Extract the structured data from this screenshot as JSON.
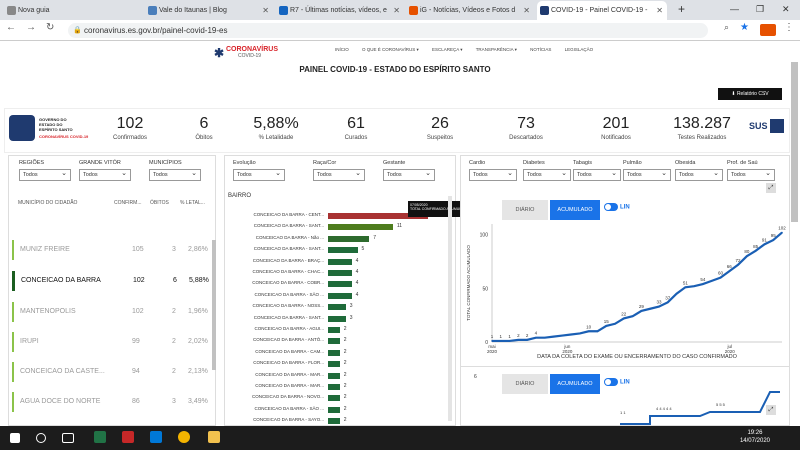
{
  "browser": {
    "tabs": [
      {
        "title": "Nova guia",
        "color": "#888888"
      },
      {
        "title": "Vale do Itaunas | Blog",
        "color": "#4a7ebb"
      },
      {
        "title": "R7 - Últimas notícias, vídeos, e",
        "color": "#1565c0"
      },
      {
        "title": "iG - Notícias, Vídeos e Fotos d",
        "color": "#e65100"
      },
      {
        "title": "COVID-19 - Painel COVID-19 - ",
        "color": "#1f3a6f"
      }
    ],
    "url": "coronavirus.es.gov.br/painel-covid-19-es",
    "new_tab": "+"
  },
  "site": {
    "logo_title": "CORONAVÍRUS",
    "logo_sub": "COVID-19",
    "menu": [
      "INÍCIO",
      "O QUE É CORONAVÍRUS ▾",
      "ESCLAREÇA ▾",
      "TRANSPARÊNCIA ▾",
      "NOTÍCIAS",
      "LEGISLAÇÃO"
    ],
    "page_title": "PAINEL COVID-19 - ESTADO DO ESPÍRITO SANTO",
    "csv_button": "⬇ Relatório CSV"
  },
  "gov": {
    "line1": "GOVERNO DO ESTADO DO ESPÍRITO SANTO",
    "line2": "CORONAVÍRUS COVID-19",
    "sus": "SUS"
  },
  "kpis": [
    {
      "value": "102",
      "label": "Confirmados"
    },
    {
      "value": "6",
      "label": "Óbitos"
    },
    {
      "value": "5,88%",
      "label": "% Letalidade"
    },
    {
      "value": "61",
      "label": "Curados"
    },
    {
      "value": "26",
      "label": "Suspeitos"
    },
    {
      "value": "73",
      "label": "Descartados"
    },
    {
      "value": "201",
      "label": "Notificados"
    },
    {
      "value": "138.287",
      "label": "Testes Realizados"
    }
  ],
  "filters_left": [
    {
      "label": "REGIÕES",
      "value": "Todos"
    },
    {
      "label": "GRANDE VITÓR",
      "value": "Todos"
    },
    {
      "label": "MUNICÍPIOS",
      "value": "Todos"
    }
  ],
  "filters_mid": [
    {
      "label": "Evolução",
      "value": "Todos"
    },
    {
      "label": "Raça/Cor",
      "value": "Todos"
    },
    {
      "label": "Gestante",
      "value": "Todos"
    }
  ],
  "filters_right": [
    {
      "label": "Cardio",
      "value": "Todos"
    },
    {
      "label": "Diabetes",
      "value": "Todos"
    },
    {
      "label": "Tabagis",
      "value": "Todos"
    },
    {
      "label": "Pulmão",
      "value": "Todos"
    },
    {
      "label": "Obesida",
      "value": "Todos"
    },
    {
      "label": "Prof. de Saú",
      "value": "Todos"
    }
  ],
  "mun_table": {
    "headers": [
      "MUNICÍPIO DO CIDADÃO",
      "CONFIRM...",
      "ÓBITOS",
      "% LETAL..."
    ],
    "rows": [
      {
        "name": "MUNIZ FREIRE",
        "conf": "105",
        "ob": "3",
        "let": "2,86%"
      },
      {
        "name": "CONCEICAO DA BARRA",
        "conf": "102",
        "ob": "6",
        "let": "5,88%"
      },
      {
        "name": "MANTENOPOLIS",
        "conf": "102",
        "ob": "2",
        "let": "1,96%"
      },
      {
        "name": "IRUPI",
        "conf": "99",
        "ob": "2",
        "let": "2,02%"
      },
      {
        "name": "CONCEICAO DA CASTE...",
        "conf": "94",
        "ob": "2",
        "let": "2,13%"
      },
      {
        "name": "AGUA DOCE DO NORTE",
        "conf": "86",
        "ob": "3",
        "let": "3,49%"
      }
    ]
  },
  "bairro": {
    "title": "BAIRRO",
    "tooltip_date": "07/05/2020",
    "tooltip_text": "TOTAL CONFIRMADO ACUMULADO",
    "rows": [
      {
        "label": "CONCEICAO DA BARRA - CENT...",
        "value": 17,
        "color": "#a83232"
      },
      {
        "label": "CONCEICAO DA BARRA - SANT...",
        "value": 11,
        "color": "#4e7d1e"
      },
      {
        "label": "CONCEICAO DA BARRA - Não ...",
        "value": 7,
        "color": "#2e6b2e"
      },
      {
        "label": "CONCEICAO DA BARRA - SANT...",
        "value": 5,
        "color": "#1f6b3a"
      },
      {
        "label": "CONCEICAO DA BARRA - BRAÇ...",
        "value": 4,
        "color": "#1f6b3a"
      },
      {
        "label": "CONCEICAO DA BARRA - CHAC...",
        "value": 4,
        "color": "#1f6b3a"
      },
      {
        "label": "CONCEICAO DA BARRA - COBR...",
        "value": 4,
        "color": "#1f6b3a"
      },
      {
        "label": "CONCEICAO DA BARRA - SÃO ...",
        "value": 4,
        "color": "#1f6b3a"
      },
      {
        "label": "CONCEICAO DA BARRA - NOSS...",
        "value": 3,
        "color": "#1f6b3a"
      },
      {
        "label": "CONCEICAO DA BARRA - SANT...",
        "value": 3,
        "color": "#1f6b3a"
      },
      {
        "label": "CONCEICAO DA BARRA - AGUI...",
        "value": 2,
        "color": "#1f6b3a"
      },
      {
        "label": "CONCEICAO DA BARRA - ANTÔ...",
        "value": 2,
        "color": "#1f6b3a"
      },
      {
        "label": "CONCEICAO DA BARRA - CAM...",
        "value": 2,
        "color": "#1f6b3a"
      },
      {
        "label": "CONCEICAO DA BARRA - FLOR...",
        "value": 2,
        "color": "#1f6b3a"
      },
      {
        "label": "CONCEICAO DA BARRA - MAR...",
        "value": 2,
        "color": "#1f6b3a"
      },
      {
        "label": "CONCEICAO DA BARRA - MAR...",
        "value": 2,
        "color": "#1f6b3a"
      },
      {
        "label": "CONCEICAO DA BARRA - NOVO...",
        "value": 2,
        "color": "#1f6b3a"
      },
      {
        "label": "CONCEICAO DA BARRA - SÃO ...",
        "value": 2,
        "color": "#1f6b3a"
      },
      {
        "label": "CONCEICAO DA BARRA - SAYO...",
        "value": 2,
        "color": "#1f6b3a"
      }
    ]
  },
  "toggles": {
    "diario": "DIÁRIO",
    "acumulado": "ACUMULADO",
    "lin": "LIN"
  },
  "chart_data": {
    "type": "line",
    "xlabel": "DATA DA COLETA DO EXAME OU ENCERRAMENTO DO CASO CONFIRMADO",
    "ylabel": "TOTAL CONFIRMADO ACUMULADO",
    "xticks": [
      "mai 2020",
      "jun 2020",
      "jul 2020"
    ],
    "ylim": [
      0,
      110
    ],
    "yticks": [
      0,
      50,
      100
    ],
    "values": [
      1,
      1,
      1,
      2,
      2,
      4,
      4,
      5,
      6,
      7,
      8,
      10,
      10,
      15,
      17,
      22,
      24,
      29,
      31,
      33,
      37,
      45,
      51,
      52,
      54,
      57,
      60,
      66,
      72,
      80,
      85,
      91,
      95,
      102
    ],
    "labels": [
      "1",
      "1",
      "1",
      "2",
      "2",
      "4",
      "",
      "",
      "",
      "",
      "",
      "10",
      "",
      "15",
      "",
      "22",
      "",
      "29",
      "",
      "33",
      "37",
      "",
      "51",
      "",
      "54",
      "",
      "60",
      "66",
      "72",
      "80",
      "85",
      "91",
      "95",
      "102"
    ],
    "line_color": "#1a5fb4"
  },
  "chart2": {
    "ytick_top": "6",
    "labels": [
      "1 1",
      "4 4 4 4 4",
      "5 5 5"
    ]
  },
  "taskbar": {
    "time": "19:26",
    "date": "14/07/2020"
  }
}
